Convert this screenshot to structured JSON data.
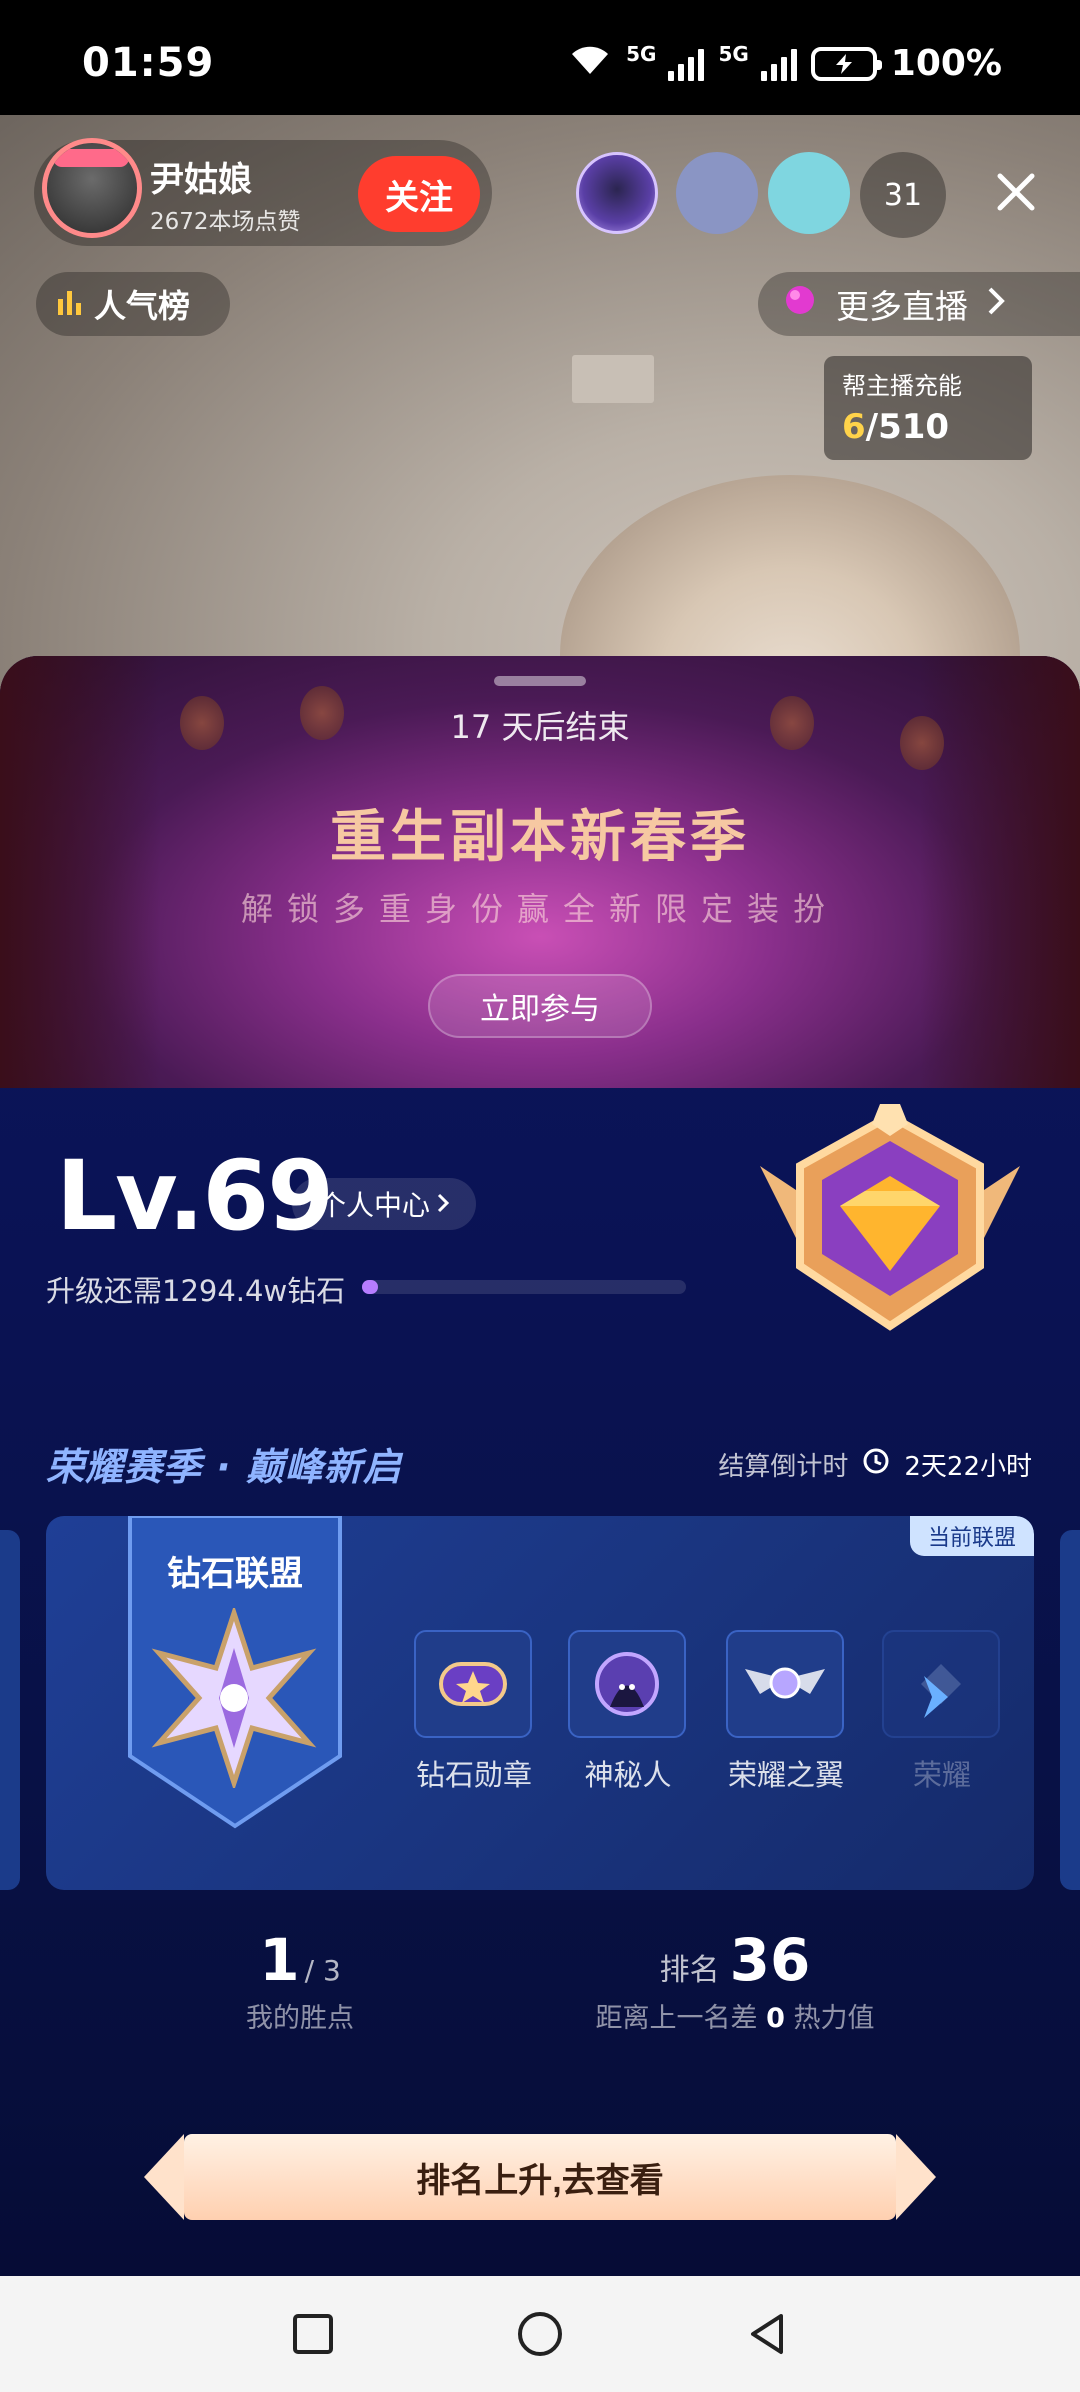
{
  "status_bar": {
    "time": "01:59",
    "net1": "5G",
    "net2": "5G",
    "battery": "100%",
    "wifi_tag": "7"
  },
  "host": {
    "name": "尹姑娘",
    "likes": "2672本场点赞",
    "follow_label": "关注"
  },
  "viewers": {
    "count": "31"
  },
  "top_actions": {
    "rank_label": "人气榜",
    "more_live_label": "更多直播"
  },
  "charge": {
    "title": "帮主播充能",
    "current": "6",
    "total": "/510"
  },
  "banner": {
    "countdown_num": "17",
    "countdown_text": "天后结束",
    "title": "重生副本新春季",
    "subtitle": "解锁多重身份赢全新限定装扮",
    "join_label": "立即参与"
  },
  "level": {
    "label": "Lv.69",
    "personal_center": "个人中心",
    "upgrade_text": "升级还需1294.4w钻石",
    "progress": 0.05
  },
  "season": {
    "title": "荣耀赛季 · 巅峰新启",
    "settle_label": "结算倒计时",
    "settle_value": "2天22小时"
  },
  "league": {
    "name": "钻石联盟",
    "current_tag": "当前联盟",
    "rewards": [
      {
        "label": "钻石勋章",
        "icon": "diamond-medal-icon"
      },
      {
        "label": "神秘人",
        "icon": "mystery-person-icon"
      },
      {
        "label": "荣耀之翼",
        "icon": "glory-wings-icon"
      },
      {
        "label": "荣耀",
        "icon": "glory-icon"
      }
    ]
  },
  "stats": {
    "points_value": "1",
    "points_total": "/ 3",
    "points_label": "我的胜点",
    "rank_label": "排名",
    "rank_value": "36",
    "gap_prefix": "距离上一名差",
    "gap_value": "0",
    "gap_suffix": "热力值"
  },
  "cta": {
    "label": "排名上升,去查看"
  },
  "colors": {
    "accent": "#ff3d2e",
    "sheet_bg": "#0a1253",
    "progress": "#b77dff"
  }
}
